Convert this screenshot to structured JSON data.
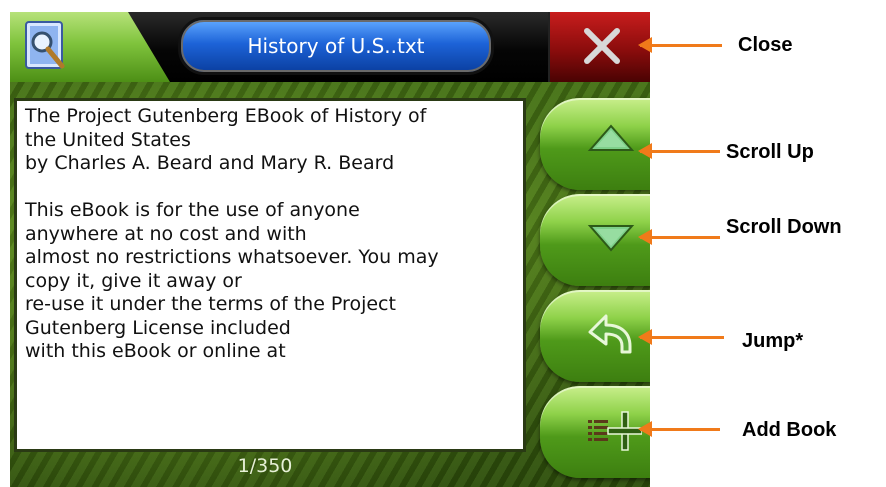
{
  "window": {
    "title": "History of U.S..txt"
  },
  "document": {
    "lines": [
      "The Project Gutenberg EBook of History of",
      "the United States",
      "by Charles A. Beard and Mary R. Beard",
      "",
      "This eBook is for the use of anyone",
      "anywhere at no cost and with",
      "almost no restrictions whatsoever.  You may",
      "copy it, give it away or",
      "re-use it under the terms of the Project",
      "Gutenberg License included",
      "with this eBook or online at"
    ],
    "page_indicator": "1/350"
  },
  "buttons": {
    "close_icon": "close-x-icon",
    "scroll_up_icon": "triangle-up-icon",
    "scroll_down_icon": "triangle-down-icon",
    "jump_icon": "back-arrow-icon",
    "add_book_icon": "list-add-icon"
  },
  "callouts": {
    "close": "Close",
    "scroll_up": "Scroll Up",
    "scroll_down": "Scroll Down",
    "jump": "Jump*",
    "add_book": "Add Book"
  },
  "colors": {
    "accent_green": "#5fae24",
    "title_blue": "#1d63d8",
    "close_red": "#a51212",
    "callout_orange": "#f07a1a"
  }
}
